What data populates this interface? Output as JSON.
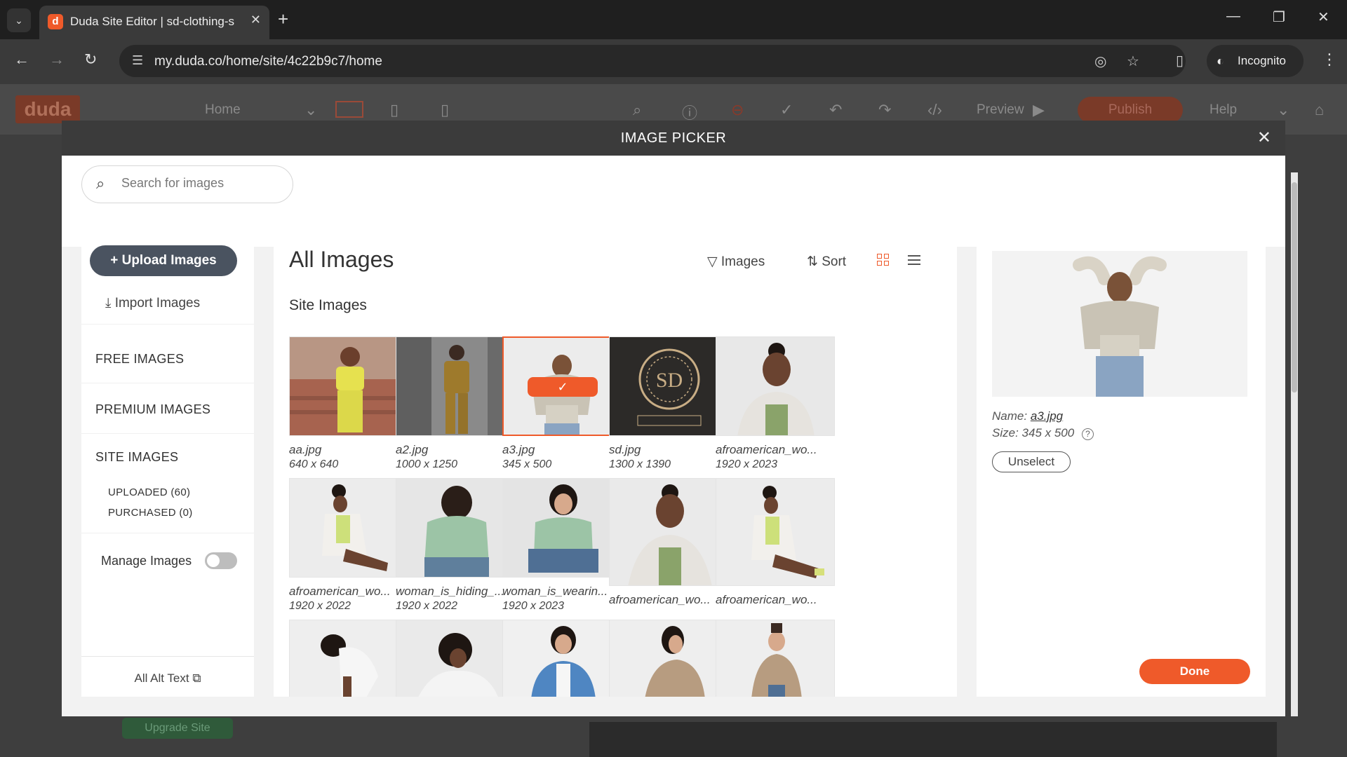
{
  "browser": {
    "tab_title": "Duda Site Editor | sd-clothing-s",
    "tab_favicon": "d",
    "url": "my.duda.co/home/site/4c22b9c7/home",
    "incognito_label": "Incognito"
  },
  "editor": {
    "logo": "duda",
    "page_select": "Home",
    "preview_label": "Preview",
    "publish_label": "Publish",
    "help_label": "Help",
    "upgrade_label": "Upgrade Site"
  },
  "modal": {
    "title": "IMAGE PICKER",
    "search_placeholder": "Search for images"
  },
  "leftnav": {
    "upload_label": "Upload Images",
    "import_label": "Import Images",
    "free_images": "FREE IMAGES",
    "premium_images": "PREMIUM IMAGES",
    "site_images": "SITE IMAGES",
    "uploaded": "UPLOADED (60)",
    "purchased": "PURCHASED (0)",
    "manage_images": "Manage Images",
    "manage_images_on": false,
    "all_alt_text": "All Alt Text"
  },
  "gallery": {
    "title": "All Images",
    "filter_label": "Images",
    "sort_label": "Sort",
    "section_title": "Site Images",
    "images": [
      {
        "name": "aa.jpg",
        "size": "640 x 640"
      },
      {
        "name": "a2.jpg",
        "size": "1000 x 1250"
      },
      {
        "name": "a3.jpg",
        "size": "345 x 500",
        "selected": true
      },
      {
        "name": "sd.jpg",
        "size": "1300 x 1390"
      },
      {
        "name": "afroamerican_wo...",
        "size": "1920 x 2023"
      },
      {
        "name": "afroamerican_wo...",
        "size": "1920 x 2022"
      },
      {
        "name": "woman_is_hiding_...",
        "size": "1920 x 2022"
      },
      {
        "name": "woman_is_wearin...",
        "size": "1920 x 2023"
      },
      {
        "name": "afroamerican_wo...",
        "size": ""
      },
      {
        "name": "afroamerican_wo...",
        "size": ""
      }
    ]
  },
  "details": {
    "name_label": "Name:",
    "name_value": "a3.jpg",
    "size_label": "Size:",
    "size_value": "345 x 500",
    "unselect_label": "Unselect",
    "done_label": "Done"
  },
  "colors": {
    "accent": "#ef5a2a",
    "header_dark": "#3b3b3b",
    "upload_button": "#4a5360"
  }
}
